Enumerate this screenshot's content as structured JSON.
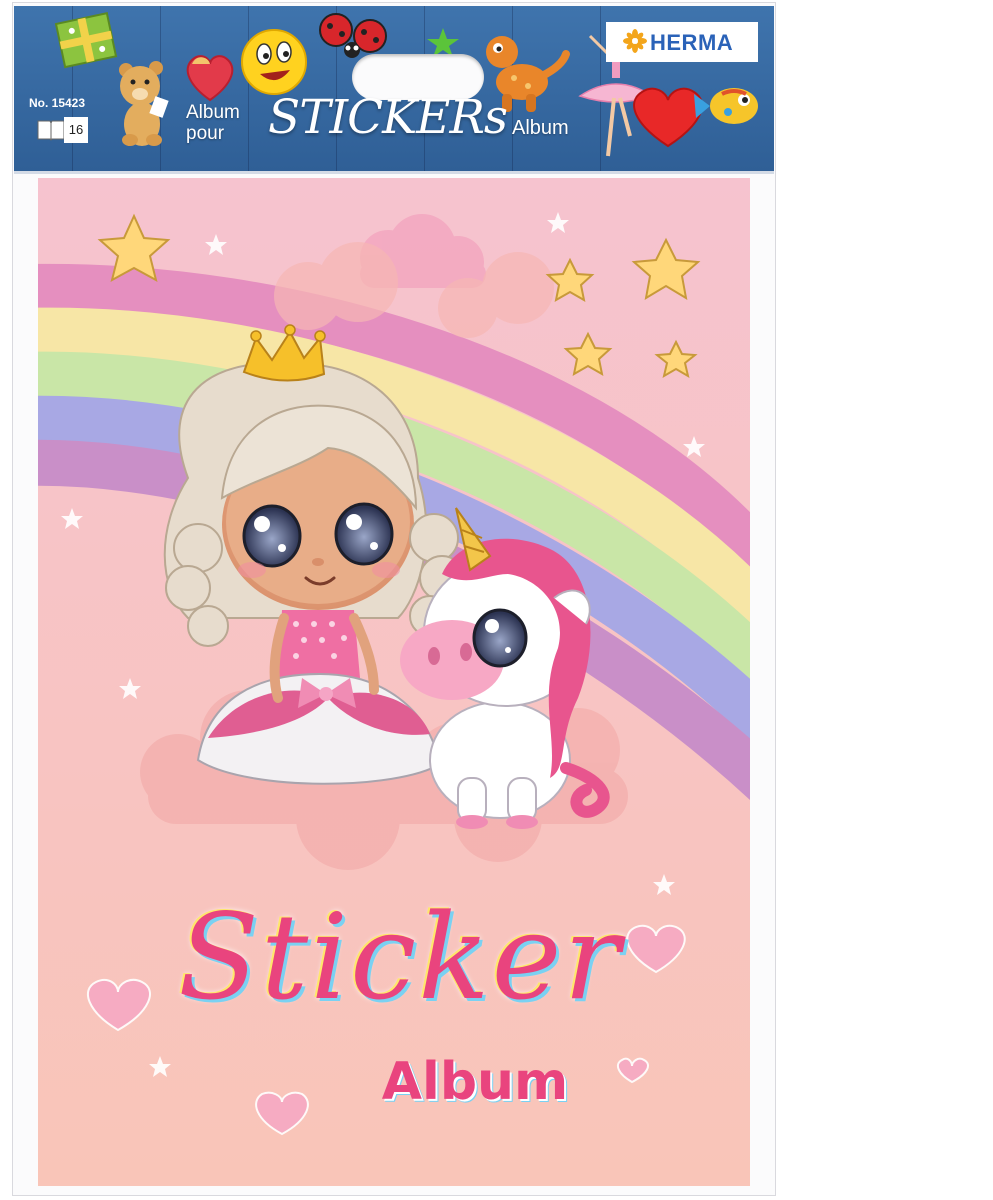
{
  "header": {
    "brand": "HERMA",
    "product_number": "No. 15423",
    "page_count": "16",
    "title_line1": "Album",
    "title_line2": "pour",
    "title_main": "STICKERs",
    "title_suffix": "Album"
  },
  "cover": {
    "title": "Sticker",
    "subtitle": "Album"
  },
  "colors": {
    "header_blue": "#3f74ad",
    "brand_blue": "#2a62b8",
    "cover_pink": "#f7c3c8",
    "title_pink": "#e9447e"
  }
}
